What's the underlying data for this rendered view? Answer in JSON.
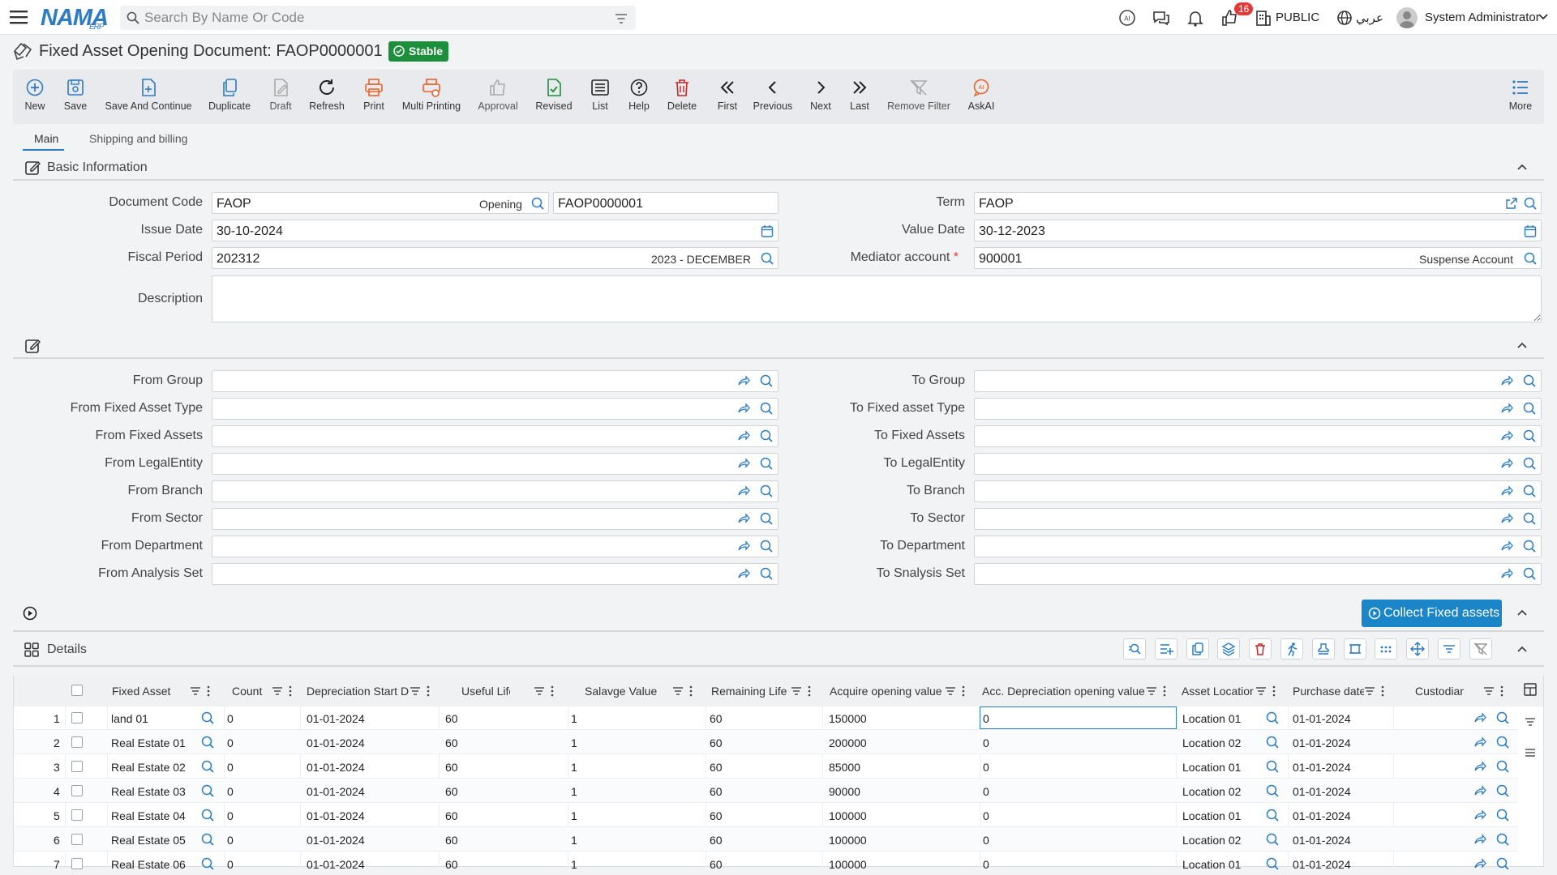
{
  "app": {
    "logo": "NAMA",
    "logo_sub": "ERP"
  },
  "search": {
    "placeholder": "Search By Name Or Code"
  },
  "topbar": {
    "notifications_count": "16",
    "public_label": "PUBLIC",
    "language": "عربي",
    "user": "System Administrator"
  },
  "page": {
    "title": "Fixed Asset Opening Document: FAOP0000001",
    "status": "Stable"
  },
  "toolbar": {
    "new": "New",
    "save": "Save",
    "save_continue": "Save And Continue",
    "duplicate": "Duplicate",
    "draft": "Draft",
    "refresh": "Refresh",
    "print": "Print",
    "multi_printing": "Multi Printing",
    "approval": "Approval",
    "revised": "Revised",
    "list": "List",
    "help": "Help",
    "delete": "Delete",
    "first": "First",
    "previous": "Previous",
    "next": "Next",
    "last": "Last",
    "remove_filter": "Remove Filter",
    "askai": "AskAI",
    "more": "More"
  },
  "tabs": {
    "main": "Main",
    "shipping": "Shipping and billing"
  },
  "basic": {
    "header": "Basic Information",
    "document_code_label": "Document Code",
    "document_code": "FAOP",
    "document_code_suffix": "Opening",
    "document_number": "FAOP0000001",
    "issue_date_label": "Issue Date",
    "issue_date": "30-10-2024",
    "fiscal_period_label": "Fiscal Period",
    "fiscal_period": "202312",
    "fiscal_period_suffix": "2023 - DECEMBER",
    "description_label": "Description",
    "term_label": "Term",
    "term": "FAOP",
    "value_date_label": "Value Date",
    "value_date": "30-12-2023",
    "mediator_label": "Mediator account",
    "mediator_required": "*",
    "mediator": "900001",
    "mediator_suffix": "Suspense Account"
  },
  "filters": {
    "from_group": "From Group",
    "from_type": "From Fixed Asset Type",
    "from_assets": "From Fixed Assets",
    "from_legal": "From LegalEntity",
    "from_branch": "From Branch",
    "from_sector": "From Sector",
    "from_department": "From Department",
    "from_analysis": "From Analysis Set",
    "to_group": "To Group",
    "to_type": "To Fixed asset Type",
    "to_assets": "To Fixed Assets",
    "to_legal": "To LegalEntity",
    "to_branch": "To Branch",
    "to_sector": "To Sector",
    "to_department": "To Department",
    "to_analysis": "To Snalysis Set"
  },
  "collect_button": "Collect Fixed assets",
  "details": {
    "header": "Details",
    "columns": [
      "Fixed Asset",
      "Count",
      "Depreciation Start D",
      "Useful Life",
      "Salavge Value",
      "Remaining Life",
      "Acquire opening value",
      "Acc. Depreciation opening value",
      "Asset Locatior",
      "Purchase date",
      "Custodian"
    ],
    "rows": [
      {
        "n": "1",
        "asset": "land 01",
        "count": "0",
        "dep_start": "01-01-2024",
        "life": "60",
        "salvage": "1",
        "remaining": "60",
        "acquire": "150000",
        "acc_dep": "0",
        "location": "Location 01",
        "purchase": "01-01-2024"
      },
      {
        "n": "2",
        "asset": "Real Estate 01",
        "count": "0",
        "dep_start": "01-01-2024",
        "life": "60",
        "salvage": "1",
        "remaining": "60",
        "acquire": "200000",
        "acc_dep": "0",
        "location": "Location 02",
        "purchase": "01-01-2024"
      },
      {
        "n": "3",
        "asset": "Real Estate 02",
        "count": "0",
        "dep_start": "01-01-2024",
        "life": "60",
        "salvage": "1",
        "remaining": "60",
        "acquire": "85000",
        "acc_dep": "0",
        "location": "Location 01",
        "purchase": "01-01-2024"
      },
      {
        "n": "4",
        "asset": "Real Estate 03",
        "count": "0",
        "dep_start": "01-01-2024",
        "life": "60",
        "salvage": "1",
        "remaining": "60",
        "acquire": "90000",
        "acc_dep": "0",
        "location": "Location 02",
        "purchase": "01-01-2024"
      },
      {
        "n": "5",
        "asset": "Real Estate 04",
        "count": "0",
        "dep_start": "01-01-2024",
        "life": "60",
        "salvage": "1",
        "remaining": "60",
        "acquire": "100000",
        "acc_dep": "0",
        "location": "Location 01",
        "purchase": "01-01-2024"
      },
      {
        "n": "6",
        "asset": "Real Estate 05",
        "count": "0",
        "dep_start": "01-01-2024",
        "life": "60",
        "salvage": "1",
        "remaining": "60",
        "acquire": "100000",
        "acc_dep": "0",
        "location": "Location 02",
        "purchase": "01-01-2024"
      },
      {
        "n": "7",
        "asset": "Real Estate 06",
        "count": "0",
        "dep_start": "01-01-2024",
        "life": "60",
        "salvage": "1",
        "remaining": "60",
        "acquire": "100000",
        "acc_dep": "0",
        "location": "Location 01",
        "purchase": "01-01-2024"
      }
    ]
  },
  "colors": {
    "accent": "#2b7bc5",
    "status_green": "#1d8f3c",
    "danger": "#e53935",
    "orange": "#e8622c"
  }
}
